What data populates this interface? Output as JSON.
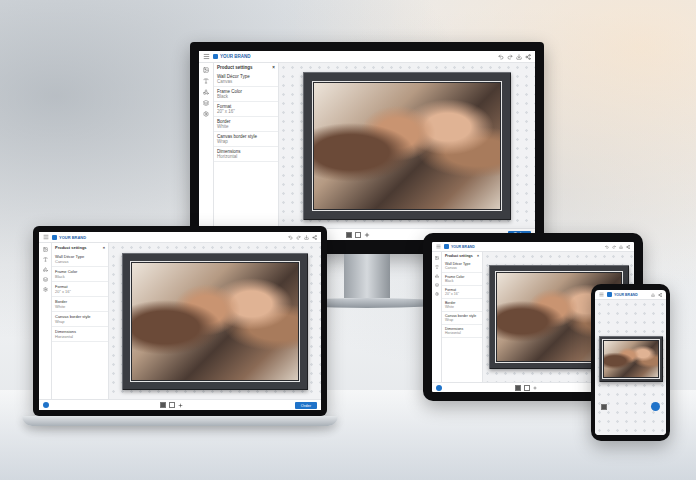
{
  "brand": {
    "name": "YOUR BRAND"
  },
  "panel": {
    "title": "Product settings",
    "close": "×",
    "items": [
      {
        "label": "Wall Décor Type",
        "value": "Canvas"
      },
      {
        "label": "Frame Color",
        "value": "Black"
      },
      {
        "label": "Format",
        "value": "20\" x 16\""
      },
      {
        "label": "Border",
        "value": "White"
      },
      {
        "label": "Canvas border style",
        "value": "Wrap"
      },
      {
        "label": "Dimensions",
        "value": "Horizontal"
      }
    ]
  },
  "order_button": "Order",
  "devices": [
    {
      "kind": "monitor",
      "panel": true
    },
    {
      "kind": "laptop",
      "panel": true
    },
    {
      "kind": "tablet",
      "panel": true
    },
    {
      "kind": "phone",
      "panel": false
    }
  ]
}
